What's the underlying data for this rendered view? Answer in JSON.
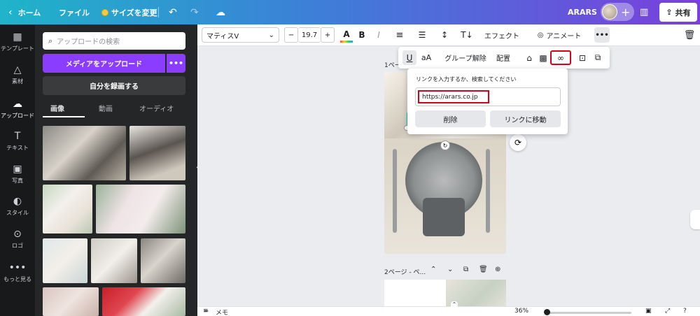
{
  "topbar": {
    "home_label": "ホーム",
    "file_label": "ファイル",
    "resize_label": "サイズを変更",
    "team_name": "ARARS",
    "share_label": "共有"
  },
  "rail": {
    "items": [
      {
        "label": "テンプレート",
        "icon": "template-icon"
      },
      {
        "label": "素材",
        "icon": "elements-icon"
      },
      {
        "label": "アップロード",
        "icon": "upload-cloud-icon"
      },
      {
        "label": "テキスト",
        "icon": "text-icon"
      },
      {
        "label": "写真",
        "icon": "photo-icon"
      },
      {
        "label": "スタイル",
        "icon": "palette-icon"
      },
      {
        "label": "ロゴ",
        "icon": "logo-icon"
      },
      {
        "label": "もっと見る",
        "icon": "more-dots-icon"
      }
    ]
  },
  "panel": {
    "search_placeholder": "アップロードの検索",
    "upload_label": "メディアをアップロード",
    "upload_more": "•••",
    "record_label": "自分を録画する",
    "tabs": [
      "画像",
      "動画",
      "オーディオ"
    ]
  },
  "toolbar": {
    "font_name": "マティスV",
    "font_size": "19.7",
    "minus": "−",
    "plus": "+",
    "effects_label": "エフェクト",
    "animate_label": "アニメート",
    "more": "•••"
  },
  "float_bar": {
    "underline": "U",
    "case": "aA",
    "ungroup": "グループ解除",
    "arrange": "配置"
  },
  "link_popover": {
    "prompt": "リンクを入力するか、検索してください",
    "url_value": "https://arars.co.jp",
    "delete_label": "削除",
    "goto_label": "リンクに移動"
  },
  "canvas": {
    "page1_label": "1ペー",
    "page2_label": "2ページ - ペ..."
  },
  "bottombar": {
    "notes_label": "メモ",
    "zoom": "36%"
  },
  "colors": {
    "accent_purple": "#8b3dff",
    "highlight_red": "#d6001c",
    "panel_dark": "#252627"
  }
}
